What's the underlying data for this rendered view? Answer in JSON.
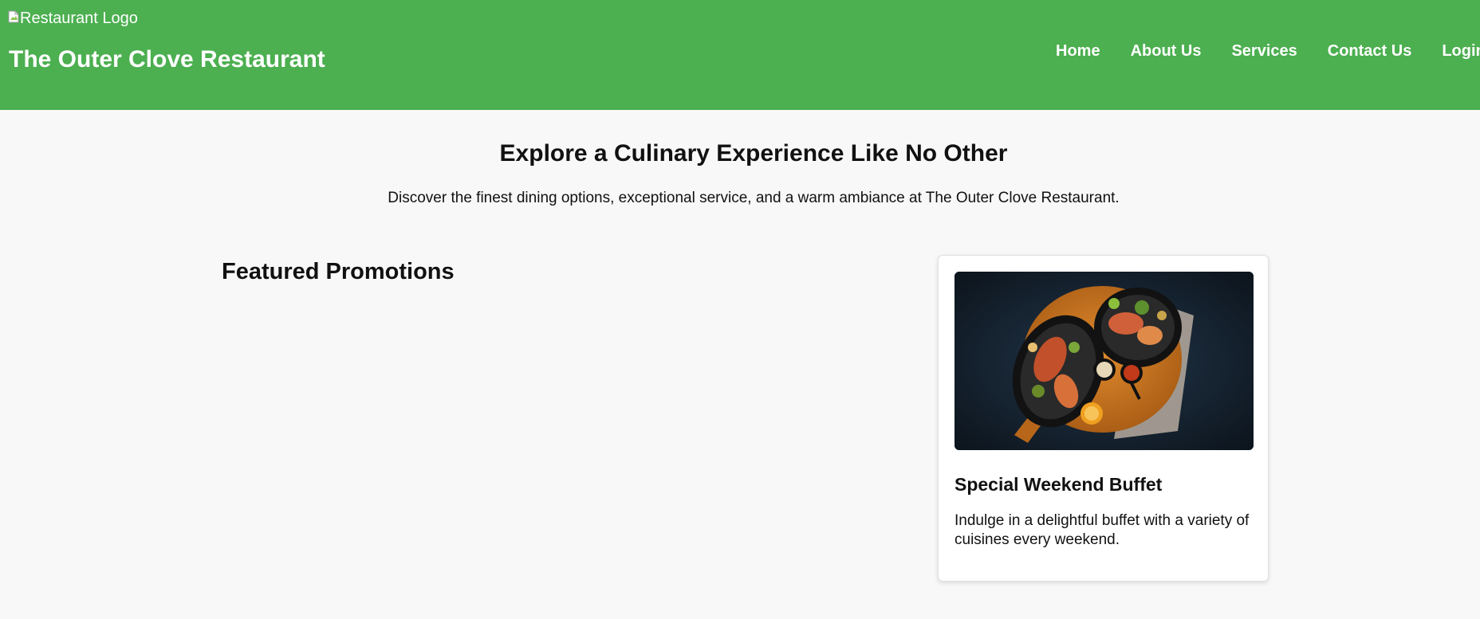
{
  "header": {
    "logo_alt": "Restaurant Logo",
    "title": "The Outer Clove Restaurant",
    "nav": [
      {
        "label": "Home"
      },
      {
        "label": "About Us"
      },
      {
        "label": "Services"
      },
      {
        "label": "Contact Us"
      },
      {
        "label": "Login"
      }
    ]
  },
  "hero": {
    "title": "Explore a Culinary Experience Like No Other",
    "subtitle": "Discover the finest dining options, exceptional service, and a warm ambiance at The Outer Clove Restaurant."
  },
  "promotions": {
    "title": "Featured Promotions",
    "cards": [
      {
        "title": "Special Weekend Buffet",
        "description": "Indulge in a delightful buffet with a variety of cuisines every weekend."
      }
    ]
  },
  "colors": {
    "header_bg": "#4caf50",
    "page_bg": "#f8f8f8"
  }
}
